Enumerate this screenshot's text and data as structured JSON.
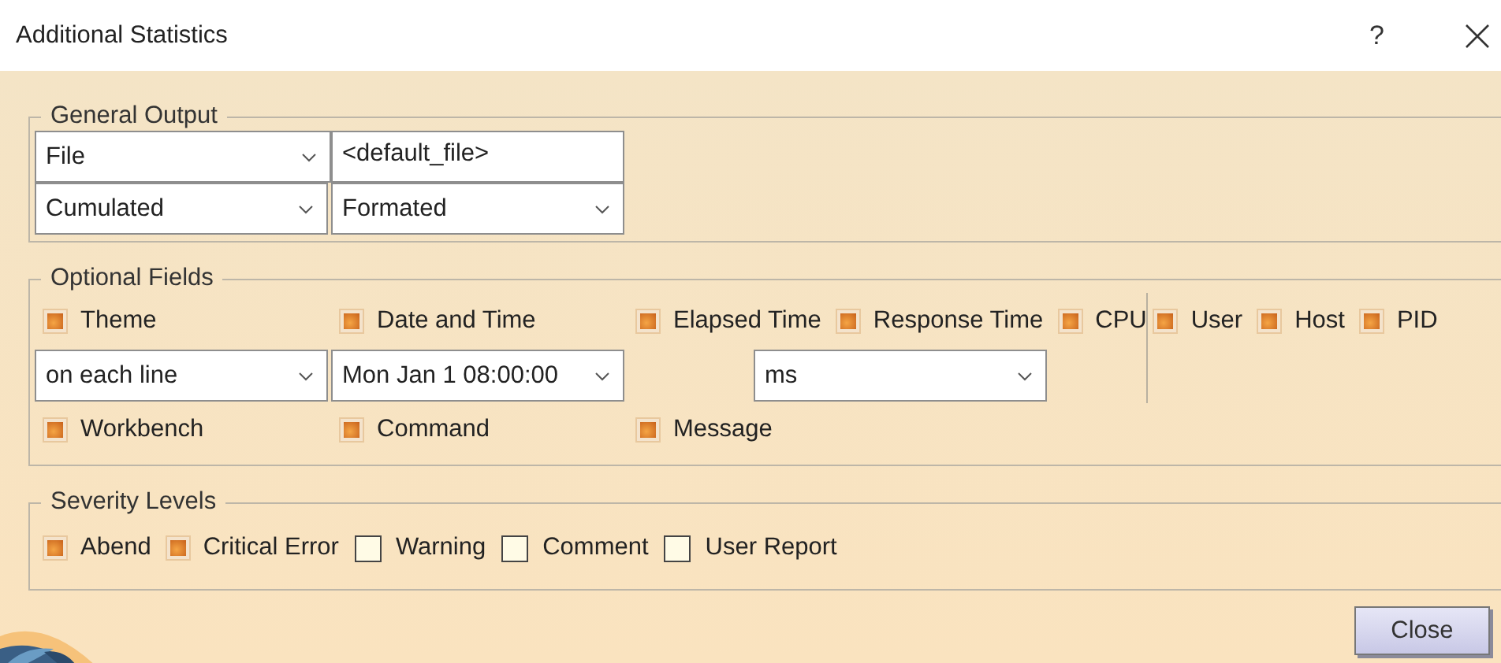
{
  "window": {
    "title": "Additional Statistics",
    "help": "?"
  },
  "general_output": {
    "legend": "General Output",
    "fields": [
      {
        "kind": "dropdown",
        "value": "File"
      },
      {
        "kind": "text",
        "value": "<default_file>"
      },
      {
        "kind": "dropdown",
        "value": "Cumulated"
      },
      {
        "kind": "dropdown",
        "value": "Formated"
      }
    ]
  },
  "optional_fields": {
    "legend": "Optional Fields",
    "left_top": [
      {
        "label": "Theme",
        "checked": true
      },
      {
        "label": "Date and Time",
        "checked": true
      }
    ],
    "left_dropdowns": [
      "on each line",
      "Mon Jan 1 08:00:00"
    ],
    "left_bottom": [
      {
        "label": "Workbench",
        "checked": true
      },
      {
        "label": "Command",
        "checked": true
      }
    ],
    "middle_top": [
      {
        "label": "Elapsed Time",
        "checked": true
      },
      {
        "label": "Response Time",
        "checked": true
      },
      {
        "label": "CPU",
        "checked": true
      }
    ],
    "middle_dropdown": "ms",
    "middle_bottom": [
      {
        "label": "Message",
        "checked": true
      }
    ],
    "right": [
      {
        "label": "User",
        "checked": true
      },
      {
        "label": "Host",
        "checked": true
      },
      {
        "label": "PID",
        "checked": true
      }
    ]
  },
  "severity_levels": {
    "legend": "Severity Levels",
    "items": [
      {
        "label": "Abend",
        "checked": true
      },
      {
        "label": "Critical Error",
        "checked": true
      },
      {
        "label": "Warning",
        "checked": false
      },
      {
        "label": "Comment",
        "checked": false
      },
      {
        "label": "User Report",
        "checked": false
      }
    ]
  },
  "buttons": [
    {
      "label": "Close"
    }
  ]
}
